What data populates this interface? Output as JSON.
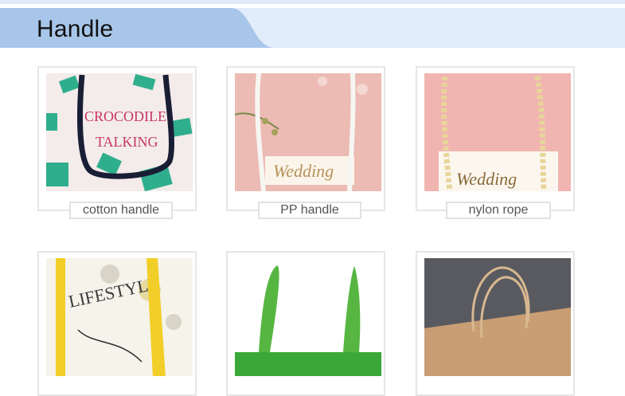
{
  "section": {
    "title": "Handle"
  },
  "cards": [
    {
      "caption": "cotton handle",
      "photo_text_1": "CROCODILE",
      "photo_text_2": "TALKING"
    },
    {
      "caption": "PP handle",
      "photo_text_1": "Wedding"
    },
    {
      "caption": "nylon rope",
      "photo_text_1": "Wedding"
    },
    {
      "caption": "",
      "photo_text_1": "LIFESTYLE"
    },
    {
      "caption": ""
    },
    {
      "caption": ""
    }
  ],
  "colors": {
    "header_band": "#a8c6ea",
    "header_light": "#e1edfa",
    "card_border": "#e6e6e6"
  }
}
